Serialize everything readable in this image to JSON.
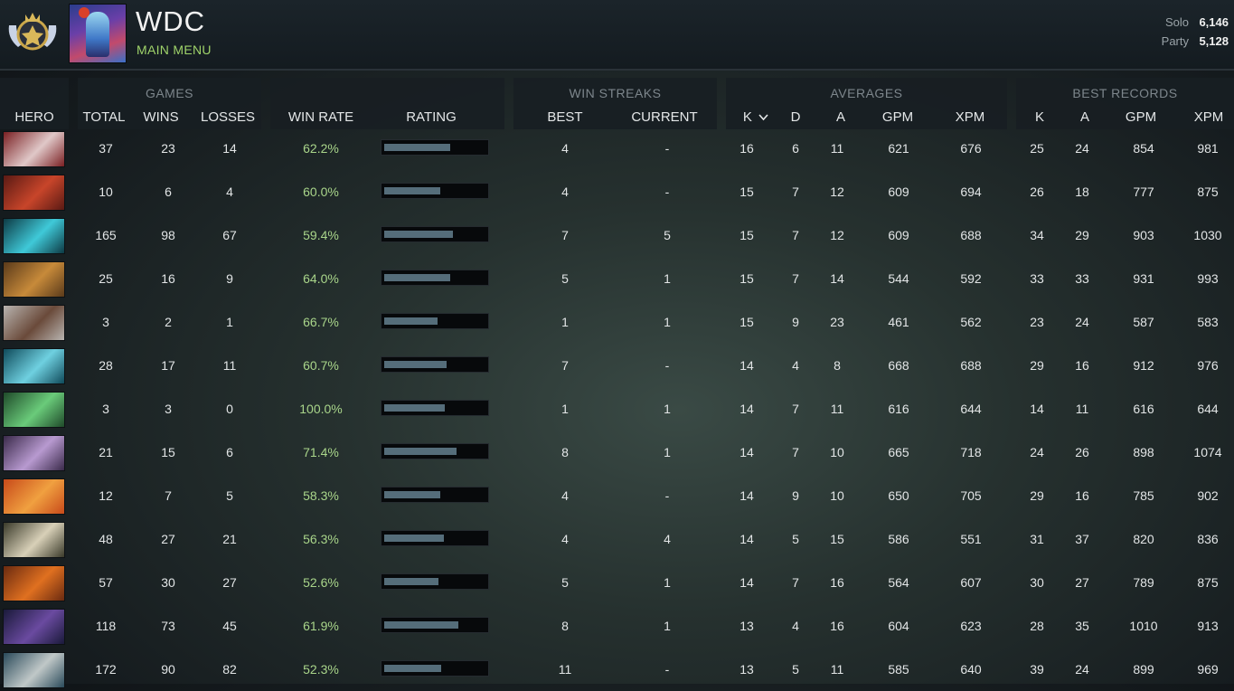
{
  "player": {
    "name": "WDC",
    "menu_label": "MAIN MENU",
    "rank_badge_icon": "rank-medal-icon"
  },
  "mmr": {
    "solo_label": "Solo",
    "solo_value": "6,146",
    "party_label": "Party",
    "party_value": "5,128"
  },
  "headers": {
    "hero": "HERO",
    "games_group": "GAMES",
    "total": "TOTAL",
    "wins": "WINS",
    "losses": "LOSSES",
    "win_rate": "WIN RATE",
    "rating": "RATING",
    "streaks_group": "WIN STREAKS",
    "best": "BEST",
    "current": "CURRENT",
    "averages_group": "AVERAGES",
    "avg_k": "K",
    "avg_d": "D",
    "avg_a": "A",
    "avg_gpm": "GPM",
    "avg_xpm": "XPM",
    "records_group": "BEST RECORDS",
    "rec_k": "K",
    "rec_a": "A",
    "rec_gpm": "GPM",
    "rec_xpm": "XPM"
  },
  "sort_icon": "chevron-down-icon",
  "rows": [
    {
      "colors": [
        "#7a1f22",
        "#e0c8c8"
      ],
      "total": "37",
      "wins": "23",
      "losses": "14",
      "win_rate": "62.2%",
      "rating": 0.65,
      "best": "4",
      "current": "-",
      "k": "16",
      "d": "6",
      "a": "11",
      "gpm": "621",
      "xpm": "676",
      "rk": "25",
      "ra": "24",
      "rgpm": "854",
      "rxpm": "981"
    },
    {
      "colors": [
        "#5a1a14",
        "#c8452a"
      ],
      "total": "10",
      "wins": "6",
      "losses": "4",
      "win_rate": "60.0%",
      "rating": 0.55,
      "best": "4",
      "current": "-",
      "k": "15",
      "d": "7",
      "a": "12",
      "gpm": "609",
      "xpm": "694",
      "rk": "26",
      "ra": "18",
      "rgpm": "777",
      "rxpm": "875"
    },
    {
      "colors": [
        "#0d3a44",
        "#3fc9d8"
      ],
      "total": "165",
      "wins": "98",
      "losses": "67",
      "win_rate": "59.4%",
      "rating": 0.68,
      "best": "7",
      "current": "5",
      "k": "15",
      "d": "7",
      "a": "12",
      "gpm": "609",
      "xpm": "688",
      "rk": "34",
      "ra": "29",
      "rgpm": "903",
      "rxpm": "1030"
    },
    {
      "colors": [
        "#5a3a1a",
        "#c78a3a"
      ],
      "total": "25",
      "wins": "16",
      "losses": "9",
      "win_rate": "64.0%",
      "rating": 0.65,
      "best": "5",
      "current": "1",
      "k": "15",
      "d": "7",
      "a": "14",
      "gpm": "544",
      "xpm": "592",
      "rk": "33",
      "ra": "33",
      "rgpm": "931",
      "rxpm": "993"
    },
    {
      "colors": [
        "#b8b4b0",
        "#6a4a3a"
      ],
      "total": "3",
      "wins": "2",
      "losses": "1",
      "win_rate": "66.7%",
      "rating": 0.53,
      "best": "1",
      "current": "1",
      "k": "15",
      "d": "9",
      "a": "23",
      "gpm": "461",
      "xpm": "562",
      "rk": "23",
      "ra": "24",
      "rgpm": "587",
      "rxpm": "583"
    },
    {
      "colors": [
        "#0f4a5a",
        "#6fd0e0"
      ],
      "total": "28",
      "wins": "17",
      "losses": "11",
      "win_rate": "60.7%",
      "rating": 0.62,
      "best": "7",
      "current": "-",
      "k": "14",
      "d": "4",
      "a": "8",
      "gpm": "668",
      "xpm": "688",
      "rk": "29",
      "ra": "16",
      "rgpm": "912",
      "rxpm": "976"
    },
    {
      "colors": [
        "#1f4a2a",
        "#6acb7a"
      ],
      "total": "3",
      "wins": "3",
      "losses": "0",
      "win_rate": "100.0%",
      "rating": 0.6,
      "best": "1",
      "current": "1",
      "k": "14",
      "d": "7",
      "a": "11",
      "gpm": "616",
      "xpm": "644",
      "rk": "14",
      "ra": "11",
      "rgpm": "616",
      "rxpm": "644"
    },
    {
      "colors": [
        "#3a2a4a",
        "#b89ad0"
      ],
      "total": "21",
      "wins": "15",
      "losses": "6",
      "win_rate": "71.4%",
      "rating": 0.71,
      "best": "8",
      "current": "1",
      "k": "14",
      "d": "7",
      "a": "10",
      "gpm": "665",
      "xpm": "718",
      "rk": "24",
      "ra": "26",
      "rgpm": "898",
      "rxpm": "1074"
    },
    {
      "colors": [
        "#c84a1a",
        "#f0a040"
      ],
      "total": "12",
      "wins": "7",
      "losses": "5",
      "win_rate": "58.3%",
      "rating": 0.55,
      "best": "4",
      "current": "-",
      "k": "14",
      "d": "9",
      "a": "10",
      "gpm": "650",
      "xpm": "705",
      "rk": "29",
      "ra": "16",
      "rgpm": "785",
      "rxpm": "902"
    },
    {
      "colors": [
        "#3a3a2a",
        "#d8d0b8"
      ],
      "total": "48",
      "wins": "27",
      "losses": "21",
      "win_rate": "56.3%",
      "rating": 0.59,
      "best": "4",
      "current": "4",
      "k": "14",
      "d": "5",
      "a": "15",
      "gpm": "586",
      "xpm": "551",
      "rk": "31",
      "ra": "37",
      "rgpm": "820",
      "rxpm": "836"
    },
    {
      "colors": [
        "#6a2a10",
        "#e07020"
      ],
      "total": "57",
      "wins": "30",
      "losses": "27",
      "win_rate": "52.6%",
      "rating": 0.54,
      "best": "5",
      "current": "1",
      "k": "14",
      "d": "7",
      "a": "16",
      "gpm": "564",
      "xpm": "607",
      "rk": "30",
      "ra": "27",
      "rgpm": "789",
      "rxpm": "875"
    },
    {
      "colors": [
        "#1a1a3a",
        "#6a4aa0"
      ],
      "total": "118",
      "wins": "73",
      "losses": "45",
      "win_rate": "61.9%",
      "rating": 0.73,
      "best": "8",
      "current": "1",
      "k": "13",
      "d": "4",
      "a": "16",
      "gpm": "604",
      "xpm": "623",
      "rk": "28",
      "ra": "35",
      "rgpm": "1010",
      "rxpm": "913"
    },
    {
      "colors": [
        "#2a4a5a",
        "#c0c8c8"
      ],
      "total": "172",
      "wins": "90",
      "losses": "82",
      "win_rate": "52.3%",
      "rating": 0.56,
      "best": "11",
      "current": "-",
      "k": "13",
      "d": "5",
      "a": "11",
      "gpm": "585",
      "xpm": "640",
      "rk": "39",
      "ra": "24",
      "rgpm": "899",
      "rxpm": "969"
    }
  ]
}
